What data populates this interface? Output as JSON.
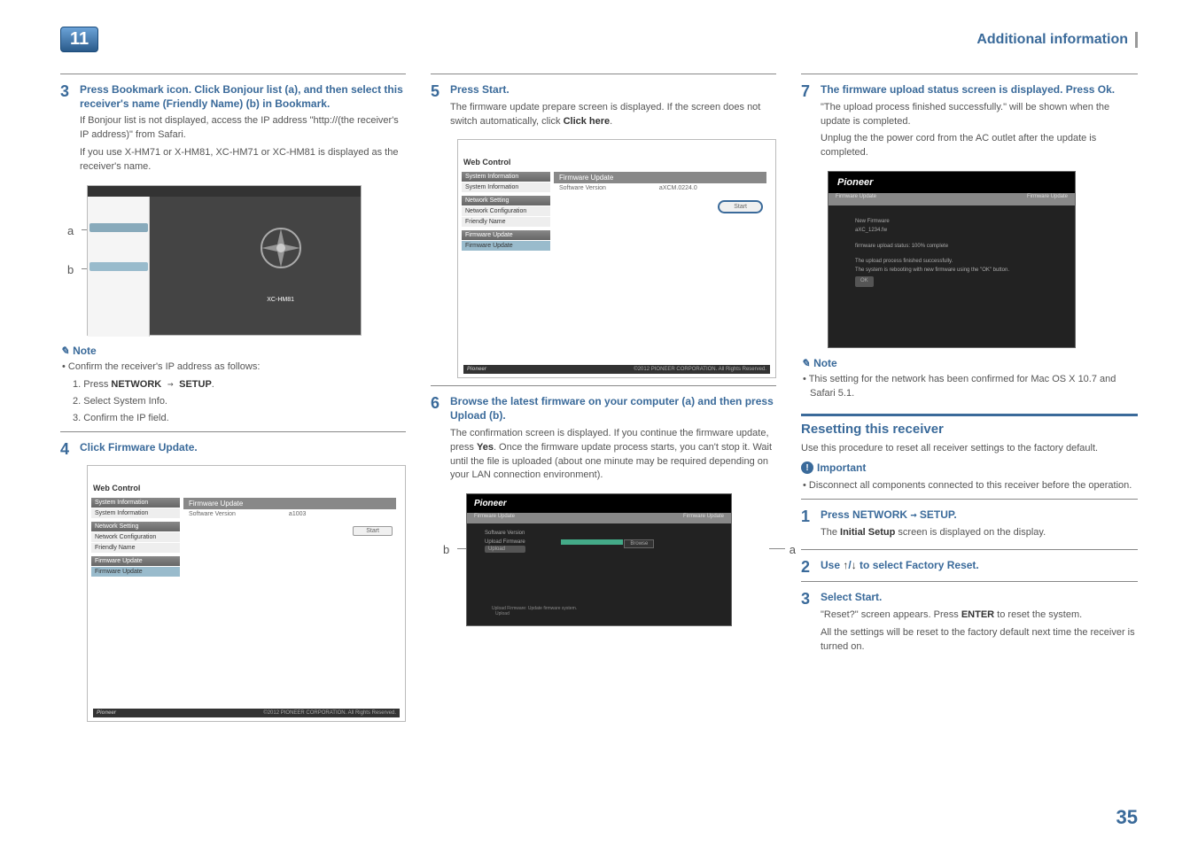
{
  "header": {
    "chapter": "11",
    "section": "Additional information"
  },
  "col1": {
    "s3": {
      "n": "3",
      "title": "Press Bookmark icon. Click Bonjour list (a), and then select this receiver's name (Friendly Name) (b) in Bookmark.",
      "p1": "If Bonjour list is not displayed, access the IP address \"http://(the receiver's IP address)\" from Safari.",
      "p2": "If you use X-HM71 or X-HM81, XC-HM71 or XC-HM81 is displayed as the receiver's name."
    },
    "ss1": {
      "a": "a",
      "b": "b",
      "xhm81": "XC-HM81"
    },
    "note": "Note",
    "nb": "• Confirm the receiver's IP address as follows:",
    "n1": "1. Press ",
    "n1b": "NETWORK",
    "n1arrow": " → ",
    "n1c": "SETUP",
    "n1d": ".",
    "n2": "2. Select System Info.",
    "n3": "3. Confirm the IP field.",
    "s4": {
      "n": "4",
      "title": "Click Firmware Update."
    },
    "ss2": {
      "wc": "Web Control",
      "si": "System Information",
      "sil": "System Information",
      "ns": "Network Setting",
      "nc": "Network Configuration",
      "fn": "Friendly Name",
      "fu1": "Firmware Update",
      "ful": "Firmware Update",
      "fuh": "Firmware Update",
      "sv": "Software Version",
      "svv": "a1003",
      "start": "Start",
      "pio": "Pioneer",
      "cp": "©2012 PIONEER CORPORATION. All Rights Reserved."
    }
  },
  "col2": {
    "s5": {
      "n": "5",
      "title": "Press Start.",
      "p1a": "The firmware update prepare screen is displayed. If the screen does not switch automatically, click ",
      "p1b": "Click here",
      "p1c": "."
    },
    "ss5": {
      "wc": "Web Control",
      "si": "System Information",
      "sil": "System Information",
      "ns": "Network Setting",
      "nc": "Network Configuration",
      "fn": "Friendly Name",
      "fu1": "Firmware Update",
      "ful": "Firmware Update",
      "fuh": "Firmware Update",
      "sv": "Software Version",
      "svv": "aXCM.0224.0",
      "start": "Start",
      "pio": "Pioneer",
      "cp": "©2012 PIONEER CORPORATION. All Rights Reserved."
    },
    "s6": {
      "n": "6",
      "title": "Browse the latest firmware on your computer (a) and then press Upload (b).",
      "p": "The confirmation screen is displayed. If you continue the firmware update, press Yes. Once the firmware update process starts, you can't stop it. Wait until the file is uploaded (about one minute may be required depending on your LAN connection environment)."
    },
    "ss6": {
      "pio": "Pioneer",
      "fu": "Firmware Update",
      "sv": "Software Version",
      "up": "Upload Firmware",
      "upl": "Upload",
      "br": "Browse",
      "a": "a",
      "b": "b",
      "ft": "Firmware Update"
    }
  },
  "col3": {
    "s7": {
      "n": "7",
      "title": "The firmware upload status screen is displayed. Press Ok.",
      "p1": "\"The upload process finished successfully.\" will be shown when the update is completed.",
      "p2": "Unplug the the power cord from the AC outlet after the update is completed."
    },
    "ss7": {
      "pio": "Pioneer",
      "fu": "Firmware Update",
      "fur": "Firmware Update",
      "nf": "New Firmware\naXC_1234.fw",
      "prog": "firmware upload status: 100% complete",
      "msg": "The upload process finished successfully.\nThe system is rebooting with new firmware using the \"OK\" button.",
      "ok": "OK"
    },
    "note": "Note",
    "nb": "• This setting for the network has been confirmed for Mac OS X 10.7 and Safari 5.1.",
    "reset": {
      "h": "Resetting this receiver",
      "p": "Use this procedure to reset all receiver settings to the factory default.",
      "imp": "Important",
      "b1": "• Disconnect all components connected to this receiver before the operation.",
      "s1n": "1",
      "s1a": "Press NETWORK ",
      "s1arrow": "→",
      "s1b": "  SETUP.",
      "s1p": "The ",
      "s1pb": "Initial Setup",
      "s1pc": " screen is displayed on the display.",
      "s2n": "2",
      "s2a": "Use ",
      "s2b": "/",
      "s2c": " to select Factory Reset.",
      "s3n": "3",
      "s3t": "Select Start.",
      "s3p1": "\"Reset?\" screen appears. Press ",
      "s3p1b": "ENTER",
      "s3p1c": " to reset the system.",
      "s3p2": "All the settings will be reset to the factory default next time the receiver is turned on."
    }
  },
  "pagenum": "35"
}
